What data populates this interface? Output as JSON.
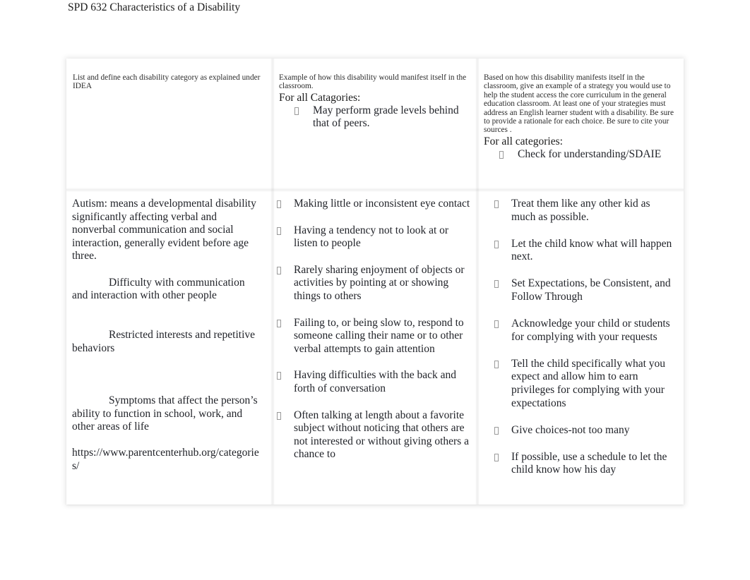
{
  "document": {
    "title": "SPD 632 Characteristics of a Disability"
  },
  "table": {
    "headers": {
      "column1": "List and define  each disability category as explained under IDEA",
      "column2": "Example of how this disability would manifest itself in the classroom.",
      "column3": "Based on how this disability manifests itself in the classroom, give an example of a strategy you would use to help the student access the core curriculum in the general education classroom. At least one of your strategies must address an English learner student with a disability.  Be sure to provide a rationale for each choice. Be sure to cite your sources   ."
    },
    "header_general": {
      "column2_label": "For all Catagories:",
      "column2_items": [
        "May perform grade levels behind that of peers."
      ],
      "column3_label": "For all categories:",
      "column3_items": [
        "Check for understanding/SDAIE"
      ]
    },
    "body": {
      "column1": {
        "definition": "Autism:  means a developmental disability significantly affecting verbal and nonverbal communication and social interaction, generally evident before age three.",
        "characteristics": [
          "Difficulty with communication and interaction with other people",
          "Restricted interests and repetitive behaviors",
          "Symptoms that affect the person’s ability to function in school, work, and other areas of life"
        ],
        "source_url": "https://www.parentcenterhub.org/categories/"
      },
      "column2_items": [
        "Making little or inconsistent eye contact",
        "Having a tendency not to look at or listen to people",
        "Rarely sharing enjoyment of objects or activities by pointing at or showing things to others",
        "Failing to, or being slow to, respond to someone calling their name or to other verbal attempts to gain attention",
        "Having difficulties with the back and forth of conversation",
        "Often talking at length about a favorite subject without noticing that others are not interested or without giving others a chance to"
      ],
      "column3_items": [
        "Treat them like any other kid as much as possible.",
        "Let the child know what will happen next.",
        "Set Expectations, be Consistent, and Follow Through",
        "Acknowledge your child or students for complying with your requests",
        "Tell the child specifically what you expect and allow him to earn privileges for complying with your expectations",
        "Give choices-not too many",
        "If possible, use a schedule to let the child know how his day"
      ]
    }
  },
  "colors": {
    "page_background": "#ffffff",
    "text": "#22242a",
    "header_text": "#2b2b2b",
    "bullet_glyph_border": "#9a9a9a"
  }
}
